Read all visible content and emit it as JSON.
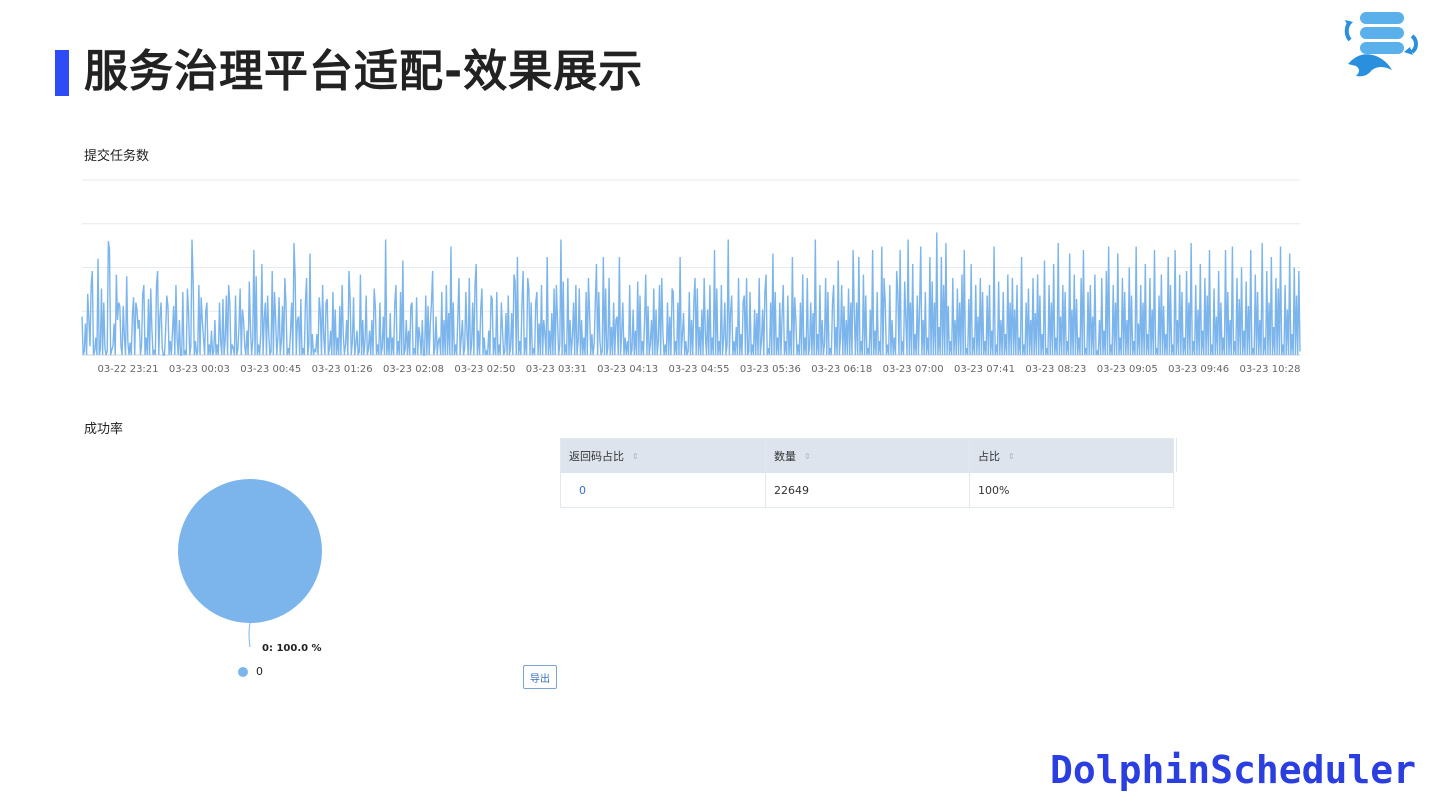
{
  "slide": {
    "title": "服务治理平台适配-效果展示",
    "brand": "DolphinScheduler",
    "accent_color": "#2f4bf5"
  },
  "line_section": {
    "title": "提交任务数"
  },
  "success_section": {
    "title": "成功率"
  },
  "chart_data": [
    {
      "type": "line",
      "title": "提交任务数",
      "xlabel": "",
      "ylabel": "",
      "x_tick_labels": [
        "03-22 23:21",
        "03-23 00:03",
        "03-23 00:45",
        "03-23 01:26",
        "03-23 02:08",
        "03-23 02:50",
        "03-23 03:31",
        "03-23 04:13",
        "03-23 04:55",
        "03-23 05:36",
        "03-23 06:18",
        "03-23 07:00",
        "03-23 07:41",
        "03-23 08:23",
        "03-23 09:05",
        "03-23 09:46",
        "03-23 10:28"
      ],
      "ylim": [
        0,
        100
      ],
      "grid": true,
      "color": "#7cb5ec",
      "series": [
        {
          "values": [
            22,
            0,
            2,
            18,
            0,
            35,
            20,
            5,
            40,
            48,
            0,
            2,
            10,
            0,
            55,
            0,
            3,
            38,
            0,
            30,
            4,
            0,
            2,
            65,
            60,
            0,
            3,
            5,
            18,
            0,
            46,
            20,
            30,
            28,
            5,
            0,
            28,
            10,
            0,
            45,
            8,
            0,
            7,
            0,
            23,
            33,
            0,
            30,
            26,
            15,
            20,
            0,
            6,
            35,
            40,
            0,
            10,
            0,
            32,
            0,
            38,
            15,
            0,
            3,
            0,
            40,
            48,
            0,
            22,
            30,
            4,
            0,
            0,
            14,
            34,
            28,
            0,
            8,
            0,
            14,
            28,
            0,
            40,
            9,
            0,
            20,
            0,
            0,
            36,
            0,
            2,
            0,
            38,
            24,
            0,
            5,
            66,
            42,
            0,
            8,
            0,
            2,
            40,
            0,
            33,
            20,
            10,
            0,
            25,
            30,
            0,
            6,
            0,
            14,
            0,
            2,
            20,
            0,
            6,
            0,
            30,
            8,
            0,
            32,
            0,
            9,
            34,
            0,
            40,
            30,
            0,
            6,
            4,
            0,
            34,
            0,
            3,
            16,
            38,
            0,
            26,
            20,
            5,
            0,
            14,
            0,
            42,
            16,
            0,
            8,
            60,
            0,
            45,
            0,
            6,
            0,
            12,
            52,
            0,
            20,
            30,
            0,
            34,
            12,
            0,
            2,
            48,
            0,
            36,
            20,
            0,
            10,
            33,
            0,
            8,
            28,
            0,
            44,
            30,
            0,
            4,
            0,
            14,
            30,
            0,
            64,
            45,
            0,
            20,
            22,
            0,
            32,
            0,
            4,
            0,
            30,
            44,
            0,
            6,
            58,
            0,
            12,
            0,
            3,
            2,
            12,
            0,
            33,
            24,
            0,
            40,
            10,
            0,
            30,
            32,
            0,
            4,
            14,
            0,
            36,
            0,
            26,
            0,
            10,
            0,
            28,
            0,
            40,
            12,
            0,
            6,
            20,
            0,
            48,
            32,
            0,
            8,
            33,
            0,
            6,
            14,
            0,
            2,
            46,
            0,
            20,
            0,
            8,
            34,
            0,
            3,
            14,
            0,
            20,
            0,
            38,
            28,
            0,
            6,
            0,
            30,
            0,
            4,
            22,
            0,
            66,
            0,
            10,
            0,
            24,
            0,
            10,
            0,
            30,
            40,
            0,
            8,
            0,
            36,
            0,
            54,
            0,
            3,
            20,
            0,
            14,
            0,
            28,
            30,
            0,
            4,
            0,
            33,
            0,
            16,
            10,
            0,
            20,
            0,
            0,
            34,
            0,
            28,
            0,
            18,
            30,
            48,
            0,
            4,
            22,
            0,
            8,
            10,
            0,
            36,
            0,
            20,
            0,
            40,
            0,
            24,
            0,
            62,
            0,
            30,
            0,
            6,
            0,
            22,
            44,
            0,
            10,
            20,
            0,
            4,
            36,
            12,
            0,
            44,
            0,
            6,
            30,
            0,
            40,
            52,
            0,
            14,
            0,
            26,
            38,
            0,
            10,
            0,
            2,
            0,
            14,
            0,
            34,
            32,
            0,
            10,
            0,
            36,
            0,
            6,
            0,
            30,
            14,
            0,
            2,
            24,
            0,
            34,
            0,
            4,
            24,
            0,
            46,
            42,
            0,
            56,
            0,
            8,
            0,
            30,
            48,
            0,
            10,
            0,
            44,
            38,
            0,
            30,
            0,
            4,
            0,
            30,
            36,
            0,
            18,
            0,
            40,
            0,
            20,
            12,
            0,
            56,
            0,
            14,
            0,
            24,
            0,
            38,
            0,
            40,
            20,
            0,
            6,
            66,
            0,
            42,
            0,
            6,
            0,
            44,
            0,
            20,
            0,
            10,
            30,
            0,
            40,
            0,
            8,
            38,
            0,
            20,
            0,
            10,
            0,
            36,
            0,
            44,
            24,
            0,
            12,
            0,
            6,
            30,
            52,
            0,
            36,
            8,
            0,
            2,
            56,
            0,
            38,
            0,
            4,
            44,
            0,
            16,
            0,
            30,
            0,
            20,
            22,
            0,
            56,
            0,
            12,
            30,
            0,
            10,
            0,
            8,
            0,
            40,
            0,
            3,
            26,
            0,
            14,
            0,
            42,
            0,
            34,
            0,
            8,
            0,
            20,
            46,
            0,
            28,
            0,
            6,
            20,
            0,
            38,
            0,
            26,
            0,
            8,
            40,
            0,
            44,
            12,
            0,
            6,
            0,
            30,
            0,
            22,
            0,
            38,
            36,
            0,
            8,
            0,
            30,
            0,
            56,
            0,
            12,
            24,
            0,
            8,
            0,
            2,
            36,
            0,
            20,
            0,
            30,
            44,
            0,
            38,
            0,
            16,
            0,
            26,
            0,
            44,
            12,
            0,
            26,
            0,
            40,
            0,
            10,
            0,
            60,
            0,
            38,
            0,
            8,
            0,
            40,
            0,
            10,
            30,
            0,
            6,
            66,
            0,
            24,
            34,
            0,
            8,
            0,
            16,
            0,
            44,
            0,
            12,
            0,
            30,
            34,
            0,
            44,
            0,
            2,
            36,
            0,
            6,
            0,
            26,
            0,
            24,
            0,
            44,
            0,
            8,
            26,
            0,
            36,
            46,
            0,
            4,
            0,
            30,
            0,
            58,
            0,
            36,
            0,
            10,
            0,
            30,
            0,
            22,
            40,
            0,
            8,
            0,
            34,
            0,
            14,
            0,
            56,
            0,
            33,
            20,
            0,
            6,
            0,
            30,
            0,
            46,
            0,
            10,
            0,
            44,
            0,
            4,
            30,
            0,
            24,
            0,
            66,
            0,
            12,
            0,
            40,
            0,
            20,
            0,
            6,
            44,
            0,
            36,
            0,
            4,
            0,
            30,
            40,
            0,
            16,
            0,
            54,
            0,
            10,
            40,
            0,
            28,
            0,
            20,
            0,
            38,
            0,
            30,
            0,
            60,
            24,
            0,
            30,
            0,
            56,
            0,
            8,
            0,
            46,
            0,
            34,
            0,
            4,
            0,
            26,
            0,
            60,
            0,
            14,
            0,
            36,
            0,
            8,
            0,
            62,
            0,
            44,
            30,
            0,
            6,
            0,
            40,
            0,
            20,
            0,
            10,
            0,
            48,
            36,
            0,
            60,
            0,
            8,
            0,
            42,
            20,
            0,
            66,
            0,
            30,
            0,
            52,
            0,
            12,
            0,
            34,
            0,
            28,
            62,
            0,
            20,
            0,
            36,
            0,
            10,
            0,
            56,
            0,
            42,
            0,
            30,
            0,
            70,
            0,
            16,
            0,
            56,
            0,
            40,
            0,
            64,
            0,
            28,
            0,
            8,
            0,
            44,
            0,
            20,
            0,
            38,
            0,
            30,
            0,
            46,
            0,
            60,
            0,
            4,
            0,
            32,
            0,
            52,
            0,
            10,
            0,
            40,
            0,
            22,
            0,
            44,
            0,
            36,
            0,
            8,
            0,
            34,
            0,
            40,
            0,
            14,
            0,
            62,
            0,
            6,
            0,
            42,
            0,
            20,
            0,
            36,
            0,
            12,
            0,
            46,
            0,
            30,
            0,
            44,
            0,
            26,
            0,
            40,
            0,
            10,
            0,
            56,
            0,
            6,
            0,
            30,
            0,
            38,
            0,
            20,
            0,
            44,
            0,
            24,
            0,
            46,
            0,
            34,
            0,
            12,
            0,
            54,
            0,
            4,
            0,
            40,
            0,
            30,
            0,
            52,
            0,
            10,
            0,
            64,
            0,
            22,
            0,
            40,
            0,
            36,
            0,
            8,
            0,
            58,
            0,
            26,
            0,
            46,
            0,
            32,
            0,
            10,
            0,
            44,
            0,
            60,
            0,
            4,
            0,
            36,
            0,
            40,
            0,
            22,
            0,
            46,
            0,
            2,
            0,
            20,
            0,
            44,
            0,
            14,
            0,
            48,
            0,
            62,
            0,
            6,
            0,
            40,
            0,
            30,
            0,
            58,
            0,
            10,
            0,
            44,
            0,
            36,
            0,
            20,
            0,
            50,
            0,
            34,
            0,
            8,
            0,
            62,
            0,
            18,
            0,
            40,
            0,
            30,
            0,
            52,
            0,
            12,
            0,
            44,
            0,
            26,
            0,
            60,
            0,
            4,
            0,
            34,
            0,
            46,
            0,
            28,
            0,
            12,
            0,
            56,
            0,
            40,
            0,
            6,
            0,
            60,
            0,
            20,
            0,
            46,
            0,
            36,
            0,
            10,
            0,
            48,
            0,
            30,
            0,
            64,
            0,
            8,
            0,
            40,
            0,
            26,
            0,
            52,
            0,
            14,
            0,
            44,
            0,
            34,
            0,
            60,
            0,
            6,
            0,
            38,
            0,
            22,
            0,
            48,
            0,
            30,
            0,
            10,
            0,
            60,
            0,
            36,
            0,
            20,
            0,
            62,
            0,
            8,
            0,
            44,
            0,
            32,
            0,
            50,
            0,
            14,
            0,
            42,
            0,
            28,
            0,
            60,
            0,
            4,
            0,
            46,
            0,
            36,
            0,
            20,
            0,
            64,
            0,
            10,
            0,
            48,
            0,
            30,
            0,
            56,
            0,
            16,
            0,
            44,
            0,
            38,
            0,
            62,
            0,
            6,
            0,
            40,
            0,
            26,
            0,
            58,
            0,
            12,
            0,
            50,
            0,
            34,
            0,
            48,
            2
          ]
        }
      ]
    },
    {
      "type": "pie",
      "title": "成功率",
      "slices": [
        {
          "name": "0",
          "value": 100.0
        }
      ],
      "data_label": "0: 100.0 %",
      "legend": [
        "0"
      ],
      "color": "#7cb5ec"
    }
  ],
  "table": {
    "headers": [
      "返回码占比",
      "数量",
      "占比"
    ],
    "rows": [
      [
        "0",
        "22649",
        "100%"
      ]
    ]
  },
  "export_label": "导出",
  "sort_icon": "⇕"
}
